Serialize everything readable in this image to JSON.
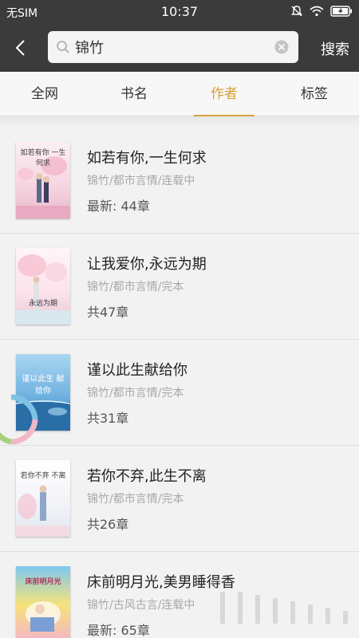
{
  "status_bar": {
    "carrier": "无SIM",
    "time": "10:37"
  },
  "search": {
    "query": "锦竹",
    "submit_label": "搜索"
  },
  "tabs": [
    {
      "label": "全网"
    },
    {
      "label": "书名"
    },
    {
      "label": "作者",
      "active": true
    },
    {
      "label": "标签"
    }
  ],
  "books": [
    {
      "title": "如若有你,一生何求",
      "meta": "锦竹/都市言情/连载中",
      "chapters": "最新: 44章",
      "cover_text": "如若有你 一生何求"
    },
    {
      "title": "让我爱你,永远为期",
      "meta": "锦竹/都市言情/完本",
      "chapters": "共47章",
      "cover_text": "永远为期"
    },
    {
      "title": "谨以此生献给你",
      "meta": "锦竹/都市言情/完本",
      "chapters": "共31章",
      "cover_text": "谨以此生 献给你"
    },
    {
      "title": "若你不弃,此生不离",
      "meta": "锦竹/都市言情/完本",
      "chapters": "共26章",
      "cover_text": "若你不弃 不离"
    },
    {
      "title": "床前明月光,美男睡得香",
      "meta": "锦竹/古风古言/连载中",
      "chapters": "最新: 65章",
      "cover_text": "床前明月光"
    }
  ],
  "colors": {
    "header_bg": "#3b3b3b",
    "accent": "#d6a13c",
    "meta_text": "#a8a8a8"
  },
  "icons": [
    "back-arrow-icon",
    "search-icon",
    "clear-icon",
    "mute-icon",
    "wifi-icon",
    "battery-icon",
    "loading-ring-icon"
  ]
}
